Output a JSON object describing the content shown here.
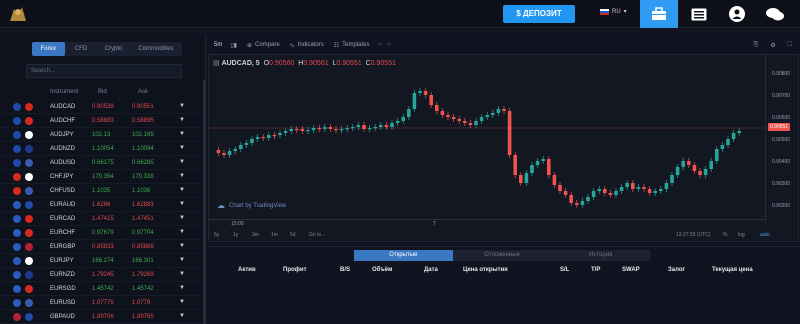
{
  "header": {
    "logo_text": "",
    "deposit_label": "$ ДЕПОЗИТ",
    "language": "RU"
  },
  "sidebar": {
    "tabs": [
      {
        "label": "Forex",
        "active": true
      },
      {
        "label": "CFD",
        "active": false
      },
      {
        "label": "Crypto",
        "active": false
      },
      {
        "label": "Commodities",
        "active": false
      }
    ],
    "search_placeholder": "Search...",
    "columns": {
      "instrument": "Instrument",
      "bid": "Bid",
      "ask": "Ask"
    },
    "rows": [
      {
        "symbol": "AUDCAD",
        "bid": "0.90539",
        "ask": "0.90551",
        "dir": "red",
        "flags": [
          "#1f4aa8",
          "#d52b1e"
        ]
      },
      {
        "symbol": "AUDCHF",
        "bid": "0.58883",
        "ask": "0.58895",
        "dir": "red",
        "flags": [
          "#1f4aa8",
          "#d52b1e"
        ]
      },
      {
        "symbol": "AUDJPY",
        "bid": "102.13",
        "ask": "102.165",
        "dir": "green",
        "flags": [
          "#1f4aa8",
          "#ffffff"
        ]
      },
      {
        "symbol": "AUDNZD",
        "bid": "1.10054",
        "ask": "1.10094",
        "dir": "green",
        "flags": [
          "#1f4aa8",
          "#1f3a8a"
        ]
      },
      {
        "symbol": "AUDUSD",
        "bid": "0.66175",
        "ask": "0.66285",
        "dir": "green",
        "flags": [
          "#1f4aa8",
          "#3a5bb0"
        ]
      },
      {
        "symbol": "CHFJPY",
        "bid": "170.354",
        "ask": "170.338",
        "dir": "green",
        "flags": [
          "#d52b1e",
          "#ffffff"
        ]
      },
      {
        "symbol": "CHFUSD",
        "bid": "1.1035",
        "ask": "1.1036",
        "dir": "green",
        "flags": [
          "#d52b1e",
          "#3a5bb0"
        ]
      },
      {
        "symbol": "EURAUD",
        "bid": "1.6286",
        "ask": "1.62883",
        "dir": "red",
        "flags": [
          "#2a5bbf",
          "#1f4aa8"
        ]
      },
      {
        "symbol": "EURCAD",
        "bid": "1.47415",
        "ask": "1.47451",
        "dir": "red",
        "flags": [
          "#2a5bbf",
          "#d52b1e"
        ]
      },
      {
        "symbol": "EURCHF",
        "bid": "0.97679",
        "ask": "0.97704",
        "dir": "green",
        "flags": [
          "#2a5bbf",
          "#d52b1e"
        ]
      },
      {
        "symbol": "EURGBP",
        "bid": "0.85833",
        "ask": "0.85868",
        "dir": "red",
        "flags": [
          "#2a5bbf",
          "#b22234"
        ]
      },
      {
        "symbol": "EURJPY",
        "bid": "166.274",
        "ask": "166.301",
        "dir": "green",
        "flags": [
          "#2a5bbf",
          "#ffffff"
        ]
      },
      {
        "symbol": "EURNZD",
        "bid": "1.79245",
        "ask": "1.79269",
        "dir": "red",
        "flags": [
          "#2a5bbf",
          "#1f3a8a"
        ]
      },
      {
        "symbol": "EURSGD",
        "bid": "1.45742",
        "ask": "1.45742",
        "dir": "green",
        "flags": [
          "#2a5bbf",
          "#d52b1e"
        ]
      },
      {
        "symbol": "EURUSD",
        "bid": "1.07775",
        "ask": "1.0779",
        "dir": "red",
        "flags": [
          "#2a5bbf",
          "#3a5bb0"
        ]
      },
      {
        "symbol": "GBPAUD",
        "bid": "1.89706",
        "ask": "1.89765",
        "dir": "red",
        "flags": [
          "#b22234",
          "#1f4aa8"
        ]
      }
    ]
  },
  "chart_toolbar": {
    "interval": "5m",
    "compare": "Compare",
    "indicators": "Indicators",
    "templates": "Templates"
  },
  "chart": {
    "symbol": "AUDCAD",
    "interval": "5",
    "open": "0.90560",
    "high": "0.90561",
    "low": "0.90551",
    "close": "0.90551",
    "watermark": "Chart by TradingView",
    "time_labels": [
      "15:00",
      "7"
    ],
    "price_labels": [
      "0.90800",
      "0.90700",
      "0.90600",
      "0.90500",
      "0.90400",
      "0.90300",
      "0.90200"
    ],
    "last_price": "0.90551",
    "ranges": [
      "5y",
      "1y",
      "3m",
      "1m",
      "5d",
      "Go to..."
    ],
    "clock": "13:27:33 (UTC)",
    "percent": "%",
    "log": "log",
    "auto": "auto",
    "up_color": "#26a69a",
    "down_color": "#ef5350"
  },
  "orders": {
    "tabs": [
      {
        "label": "Открытые",
        "active": true
      },
      {
        "label": "Отложенные",
        "active": false
      },
      {
        "label": "История",
        "active": false
      }
    ],
    "columns": [
      "Актив",
      "Профит",
      "B/S",
      "Объём",
      "Дата",
      "Цена открытия",
      "S/L",
      "T/P",
      "SWAP",
      "Залог",
      "Текущая цена"
    ]
  }
}
